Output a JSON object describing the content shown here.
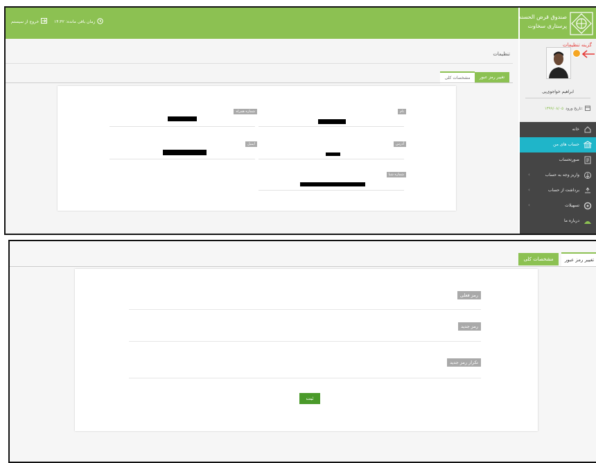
{
  "header": {
    "time_label": "زمان باقی مانده: ۱۴:۴۲",
    "logout_label": "خروج از سیستم",
    "org_line1": "صندوق قرض الحسنه",
    "org_line2": "پرستاری سخاوت"
  },
  "annotation": {
    "text": "گزینه تنظیمات",
    "color": "#e53935"
  },
  "profile": {
    "name": "ابراهیم خواجوی‌پی",
    "login_label": "تاریخ ورود:",
    "login_date": "۱۳۹۹/۰۸/۰۵"
  },
  "sidebar": {
    "items": [
      {
        "label": "خانه",
        "icon": "home-icon"
      },
      {
        "label": "حساب های من",
        "icon": "bank-icon",
        "active": true
      },
      {
        "label": "صورتحساب",
        "icon": "invoice-icon"
      },
      {
        "label": "واریز وجه به حساب",
        "icon": "deposit-icon"
      },
      {
        "label": "برداشت از حساب",
        "icon": "withdraw-icon"
      },
      {
        "label": "تسهیلات",
        "icon": "loan-icon"
      },
      {
        "label": "درباره ما",
        "icon": "about-icon"
      }
    ]
  },
  "page": {
    "breadcrumb": "تنظیمات"
  },
  "tabs": {
    "change_password": "تغییر رمز عبور",
    "general_info": "مشخصات کلی"
  },
  "profile_form": {
    "name_label": "نام",
    "mobile_label": "شماره همراه",
    "address_label": "آدرس",
    "email_label": "ایمیل",
    "sheba_label": "شماره شبا"
  },
  "password_form": {
    "current_label": "رمز فعلی",
    "new_label": "رمز جدید",
    "repeat_label": "تکرار رمز جدید",
    "submit_label": "ثبت"
  },
  "colors": {
    "brand_green": "#8cc152",
    "active_blue": "#1fb5c9",
    "sidebar_dark": "#454545",
    "submit_green": "#4a9a2a"
  }
}
